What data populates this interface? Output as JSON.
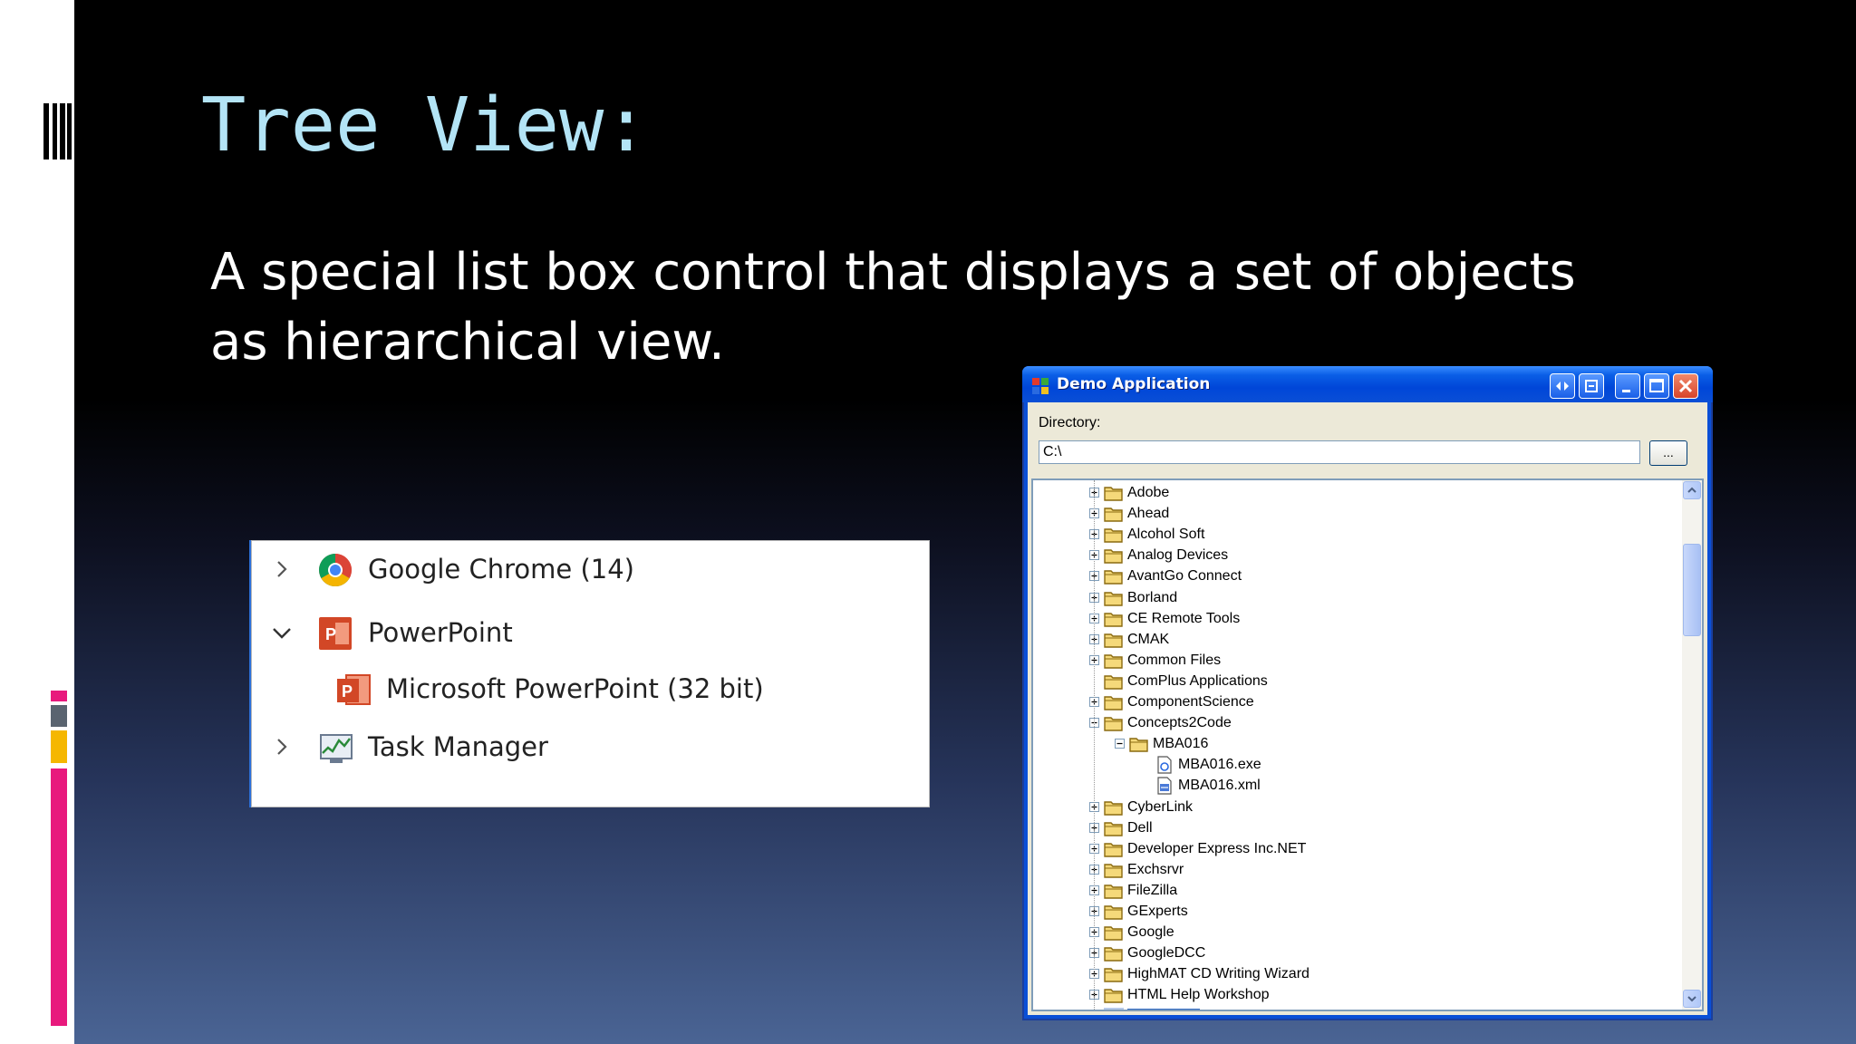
{
  "slide": {
    "title": "Tree View:",
    "body": "A special list box control that displays a set of objects as hierarchical view."
  },
  "taskbar_tree": {
    "rows": [
      {
        "label": "Google Chrome (14)",
        "icon": "chrome-icon",
        "expander": "collapsed"
      },
      {
        "label": "PowerPoint",
        "icon": "powerpoint-icon",
        "expander": "expanded"
      },
      {
        "label": "Microsoft PowerPoint (32 bit)",
        "icon": "powerpoint-icon",
        "expander": "none"
      },
      {
        "label": "Task Manager",
        "icon": "task-manager-icon",
        "expander": "collapsed"
      }
    ]
  },
  "demo_window": {
    "title": "Demo Application",
    "directory_label": "Directory:",
    "directory_value": "C:\\",
    "browse_label": "...",
    "tree_items": [
      {
        "label": "Adobe",
        "level": 0,
        "expander": "plus",
        "type": "folder"
      },
      {
        "label": "Ahead",
        "level": 0,
        "expander": "plus",
        "type": "folder"
      },
      {
        "label": "Alcohol Soft",
        "level": 0,
        "expander": "plus",
        "type": "folder"
      },
      {
        "label": "Analog Devices",
        "level": 0,
        "expander": "plus",
        "type": "folder"
      },
      {
        "label": "AvantGo Connect",
        "level": 0,
        "expander": "plus",
        "type": "folder"
      },
      {
        "label": "Borland",
        "level": 0,
        "expander": "plus",
        "type": "folder"
      },
      {
        "label": "CE Remote Tools",
        "level": 0,
        "expander": "plus",
        "type": "folder"
      },
      {
        "label": "CMAK",
        "level": 0,
        "expander": "plus",
        "type": "folder"
      },
      {
        "label": "Common Files",
        "level": 0,
        "expander": "plus",
        "type": "folder"
      },
      {
        "label": "ComPlus Applications",
        "level": 0,
        "expander": "none",
        "type": "folder"
      },
      {
        "label": "ComponentScience",
        "level": 0,
        "expander": "plus",
        "type": "folder"
      },
      {
        "label": "Concepts2Code",
        "level": 0,
        "expander": "minus",
        "type": "folder"
      },
      {
        "label": "MBA016",
        "level": 1,
        "expander": "minus",
        "type": "folder"
      },
      {
        "label": "MBA016.exe",
        "level": 2,
        "expander": "none",
        "type": "exe"
      },
      {
        "label": "MBA016.xml",
        "level": 2,
        "expander": "none",
        "type": "xml"
      },
      {
        "label": "CyberLink",
        "level": 0,
        "expander": "plus",
        "type": "folder"
      },
      {
        "label": "Dell",
        "level": 0,
        "expander": "plus",
        "type": "folder"
      },
      {
        "label": "Developer Express Inc.NET",
        "level": 0,
        "expander": "plus",
        "type": "folder"
      },
      {
        "label": "Exchsrvr",
        "level": 0,
        "expander": "plus",
        "type": "folder"
      },
      {
        "label": "FileZilla",
        "level": 0,
        "expander": "plus",
        "type": "folder"
      },
      {
        "label": "GExperts",
        "level": 0,
        "expander": "plus",
        "type": "folder"
      },
      {
        "label": "Google",
        "level": 0,
        "expander": "plus",
        "type": "folder"
      },
      {
        "label": "GoogleDCC",
        "level": 0,
        "expander": "plus",
        "type": "folder"
      },
      {
        "label": "HighMAT CD Writing Wizard",
        "level": 0,
        "expander": "plus",
        "type": "folder"
      },
      {
        "label": "HTML Help Workshop",
        "level": 0,
        "expander": "plus",
        "type": "folder"
      },
      {
        "label": "",
        "level": 0,
        "expander": "plus",
        "type": "folder-selected"
      }
    ]
  },
  "colors": {
    "title": "#b3e4f6",
    "accent_pink": "#e8197d",
    "accent_yellow": "#f5b700",
    "accent_gray": "#5a6470",
    "xp_blue": "#0a4fd6",
    "selection_blue": "#316ac5"
  }
}
